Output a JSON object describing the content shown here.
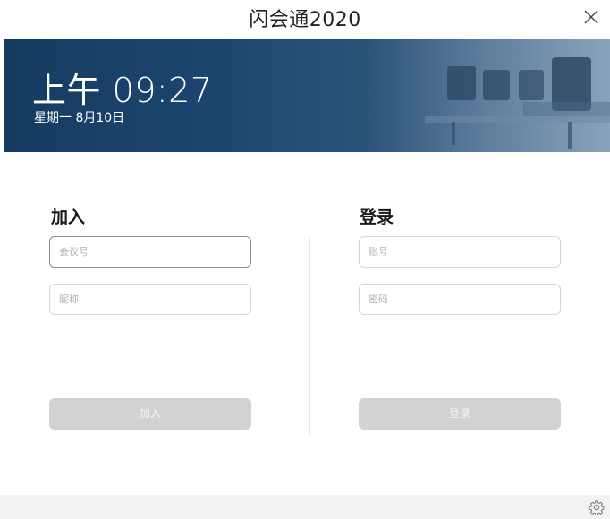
{
  "window": {
    "title": "闪会通2020"
  },
  "header": {
    "time": "上午  09:27",
    "date": "星期一   8月10日"
  },
  "join": {
    "title": "加入",
    "meeting_id_placeholder": "会议号",
    "nickname_placeholder": "昵称",
    "button_label": "加入"
  },
  "login": {
    "title": "登录",
    "account_placeholder": "账号",
    "password_placeholder": "密码",
    "button_label": "登录"
  },
  "icons": {
    "close": "close-icon",
    "settings": "gear-icon"
  },
  "colors": {
    "banner": "#1c4670",
    "button_disabled": "#d2d2d2",
    "footer": "#f2f2f2"
  }
}
